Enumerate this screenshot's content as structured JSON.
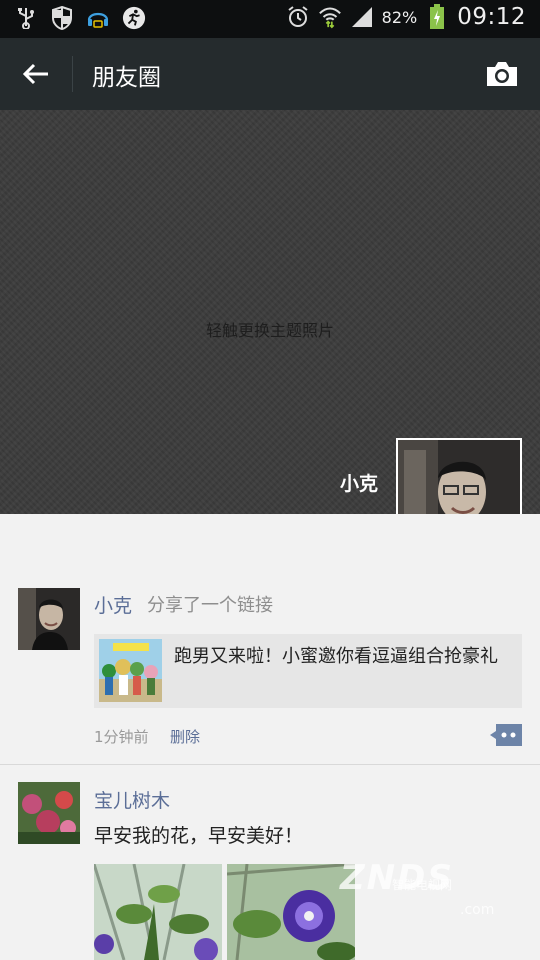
{
  "status_bar": {
    "battery_percent": "82%",
    "time": "09:12",
    "left_icons": [
      "usb-icon",
      "shield-icon",
      "headset-icon",
      "runner-icon"
    ],
    "right_icons": [
      "alarm-icon",
      "wifi-icon",
      "signal-icon",
      "battery-icon"
    ]
  },
  "header": {
    "title": "朋友圈",
    "back_icon": "arrow-left-icon",
    "camera_icon": "camera-icon"
  },
  "cover": {
    "hint": "轻触更换主题照片",
    "user_name": "小克"
  },
  "posts": [
    {
      "author": "小克",
      "action": "分享了一个链接",
      "link_title": "跑男又来啦！小蜜邀你看逗逼组合抢豪礼",
      "time": "1分钟前",
      "delete_label": "删除"
    },
    {
      "author": "宝儿树木",
      "text": "早安我的花，早安美好！"
    }
  ],
  "watermark": {
    "main": "ZNDS",
    "sub": "智能电视网",
    "domain": ".com"
  },
  "colors": {
    "name_link": "#5b6e97",
    "title_bar": "#252b2d",
    "status_bar": "#0d0f10",
    "battery": "#8bc34a"
  }
}
